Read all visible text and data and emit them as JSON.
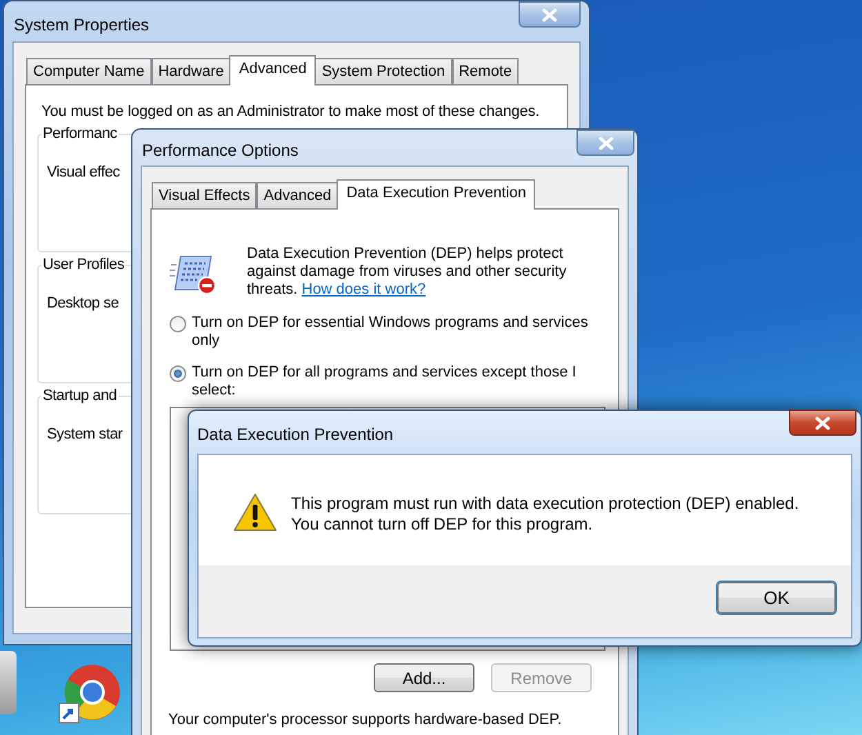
{
  "system_properties": {
    "title": "System Properties",
    "tabs": [
      {
        "label": "Computer Name",
        "selected": false
      },
      {
        "label": "Hardware",
        "selected": false
      },
      {
        "label": "Advanced",
        "selected": true
      },
      {
        "label": "System Protection",
        "selected": false
      },
      {
        "label": "Remote",
        "selected": false
      }
    ],
    "notice": "You must be logged on as an Administrator to make most of these changes.",
    "groups": [
      {
        "title": "Performanc",
        "text": "Visual effec"
      },
      {
        "title": "User Profiles",
        "text": "Desktop se"
      },
      {
        "title": "Startup and",
        "text": "System star"
      }
    ]
  },
  "performance_options": {
    "title": "Performance Options",
    "tabs": [
      {
        "label": "Visual Effects",
        "selected": false
      },
      {
        "label": "Advanced",
        "selected": false
      },
      {
        "label": "Data Execution Prevention",
        "selected": true
      }
    ],
    "description": "Data Execution Prevention (DEP) helps protect against damage from viruses and other security threats.",
    "link": "How does it work?",
    "options": [
      {
        "label": "Turn on DEP for essential Windows programs and services only",
        "selected": false
      },
      {
        "label": "Turn on DEP for all programs and services except those I select:",
        "selected": true
      }
    ],
    "buttons": [
      {
        "label": "Add...",
        "disabled": false
      },
      {
        "label": "Remove",
        "disabled": true
      }
    ],
    "footer": "Your computer's processor supports hardware-based DEP."
  },
  "dialog": {
    "title": "Data Execution Prevention",
    "message": [
      "This program must run with data execution protection (DEP) enabled.",
      "You cannot turn off DEP for this program."
    ],
    "button": "OK"
  }
}
